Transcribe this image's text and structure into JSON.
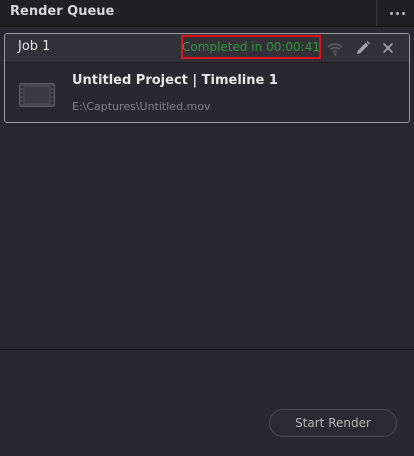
{
  "panel": {
    "title": "Render Queue"
  },
  "job": {
    "name": "Job 1",
    "status": "Completed in 00:00:41",
    "title": "Untitled Project | Timeline 1",
    "path": "E:\\Captures\\Untitled.mov",
    "status_color": "#2e9a3a",
    "highlight_color": "#e0141e"
  },
  "icons": {
    "more": "more-horizontal-icon",
    "remote": "wireless-icon",
    "edit": "pencil-icon",
    "close": "close-icon",
    "thumbnail": "film-clip-icon"
  },
  "actions": {
    "start_render": "Start Render"
  }
}
